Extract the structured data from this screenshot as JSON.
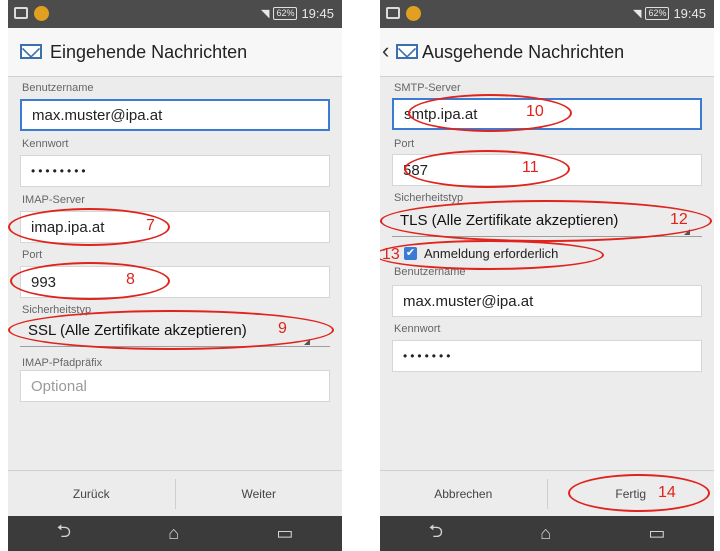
{
  "status_bar": {
    "battery": "62%",
    "time": "19:45"
  },
  "left": {
    "title": "Eingehende Nachrichten",
    "username_label": "Benutzername",
    "username_value": "max.muster@ipa.at",
    "password_label": "Kennwort",
    "password_value": "••••••••",
    "server_label": "IMAP-Server",
    "server_value": "imap.ipa.at",
    "port_label": "Port",
    "port_value": "993",
    "security_label": "Sicherheitstyp",
    "security_value": "SSL (Alle Zertifikate akzeptieren)",
    "prefix_label": "IMAP-Pfadpräfix",
    "prefix_placeholder": "Optional",
    "back_button": "Zurück",
    "next_button": "Weiter",
    "annotations": [
      "7",
      "8",
      "9"
    ]
  },
  "right": {
    "title": "Ausgehende Nachrichten",
    "server_label": "SMTP-Server",
    "server_value": "smtp.ipa.at",
    "port_label": "Port",
    "port_value": "587",
    "security_label": "Sicherheitstyp",
    "security_value": "TLS (Alle Zertifikate akzeptieren)",
    "auth_label": "Anmeldung erforderlich",
    "auth_checked": true,
    "username_label": "Benutzername",
    "username_value": "max.muster@ipa.at",
    "password_label": "Kennwort",
    "password_value": "•••••••",
    "cancel_button": "Abbrechen",
    "done_button": "Fertig",
    "annotations": [
      "10",
      "11",
      "12",
      "13",
      "14"
    ]
  },
  "icons": {
    "checkbox": "✔",
    "back": "⮌",
    "home": "⌂",
    "recents": "▭",
    "chevron": "‹"
  },
  "colors": {
    "annotation": "#e0231c",
    "accent": "#3b7bd4"
  }
}
